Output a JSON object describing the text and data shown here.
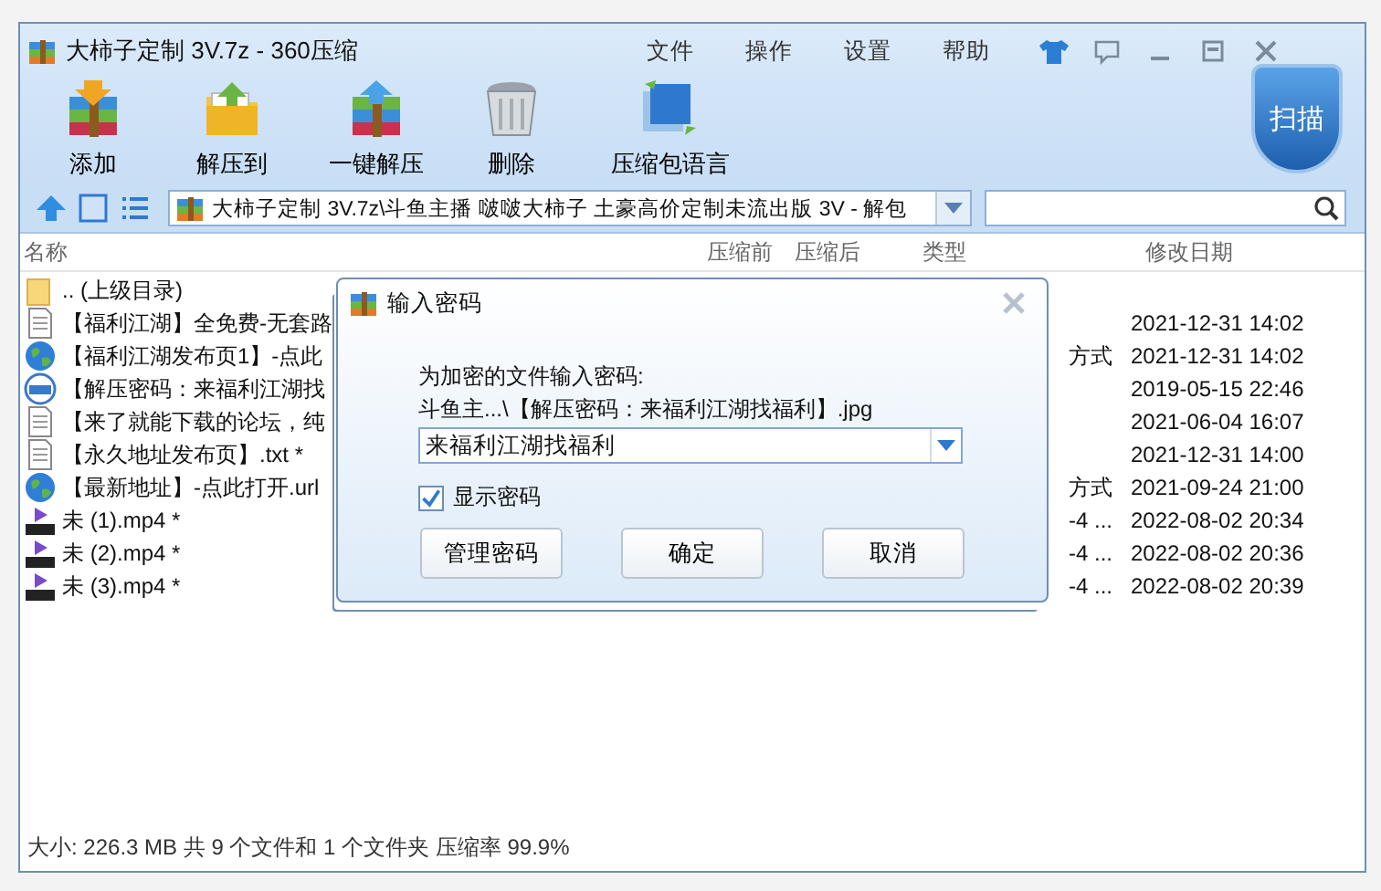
{
  "window": {
    "title": "大柿子定制 3V.7z - 360压缩"
  },
  "menu": [
    "文件",
    "操作",
    "设置",
    "帮助"
  ],
  "toolbar": [
    {
      "label": "添加",
      "kind": "add"
    },
    {
      "label": "解压到",
      "kind": "extract-to"
    },
    {
      "label": "一键解压",
      "kind": "extract"
    },
    {
      "label": "删除",
      "kind": "delete"
    },
    {
      "label": "压缩包语言",
      "kind": "language"
    }
  ],
  "scan_button": "扫描",
  "address": {
    "value": "大柿子定制 3V.7z\\斗鱼主播 啵啵大柿子 土豪高价定制未流出版 3V - 解包"
  },
  "table": {
    "columns": [
      "名称",
      "压缩前",
      "压缩后",
      "类型",
      "修改日期"
    ],
    "rows": [
      {
        "kind": "folder",
        "name": ".. (上级目录)"
      },
      {
        "kind": "text",
        "name": "【福利江湖】全免费-无套路",
        "modified": "2021-12-31 14:02"
      },
      {
        "kind": "web",
        "name": "【福利江湖发布页1】-点此",
        "type": "方式",
        "modified": "2021-12-31 14:02"
      },
      {
        "kind": "jpg",
        "name": "【解压密码：来福利江湖找",
        "modified": "2019-05-15 22:46"
      },
      {
        "kind": "text",
        "name": "【来了就能下载的论坛，纯",
        "modified": "2021-06-04 16:07"
      },
      {
        "kind": "text",
        "name": "【永久地址发布页】.txt *",
        "modified": "2021-12-31 14:00"
      },
      {
        "kind": "web",
        "name": "【最新地址】-点此打开.url",
        "type": "方式",
        "modified": "2021-09-24 21:00"
      },
      {
        "kind": "video",
        "name": "未 (1).mp4 *",
        "type": "-4 ...",
        "modified": "2022-08-02 20:34"
      },
      {
        "kind": "video",
        "name": "未 (2).mp4 *",
        "type": "-4 ...",
        "modified": "2022-08-02 20:36"
      },
      {
        "kind": "video",
        "name": "未 (3).mp4 *",
        "type": "-4 ...",
        "modified": "2022-08-02 20:39"
      }
    ]
  },
  "status_bar": "大小: 226.3 MB 共 9 个文件和 1 个文件夹 压缩率 99.9%",
  "dialog": {
    "title": "输入密码",
    "prompt": "为加密的文件输入密码:",
    "file": "斗鱼主...\\【解压密码：来福利江湖找福利】.jpg",
    "password": "来福利江湖找福利",
    "show_password": {
      "label": "显示密码",
      "checked": true
    },
    "buttons": [
      "管理密码",
      "确定",
      "取消"
    ]
  }
}
